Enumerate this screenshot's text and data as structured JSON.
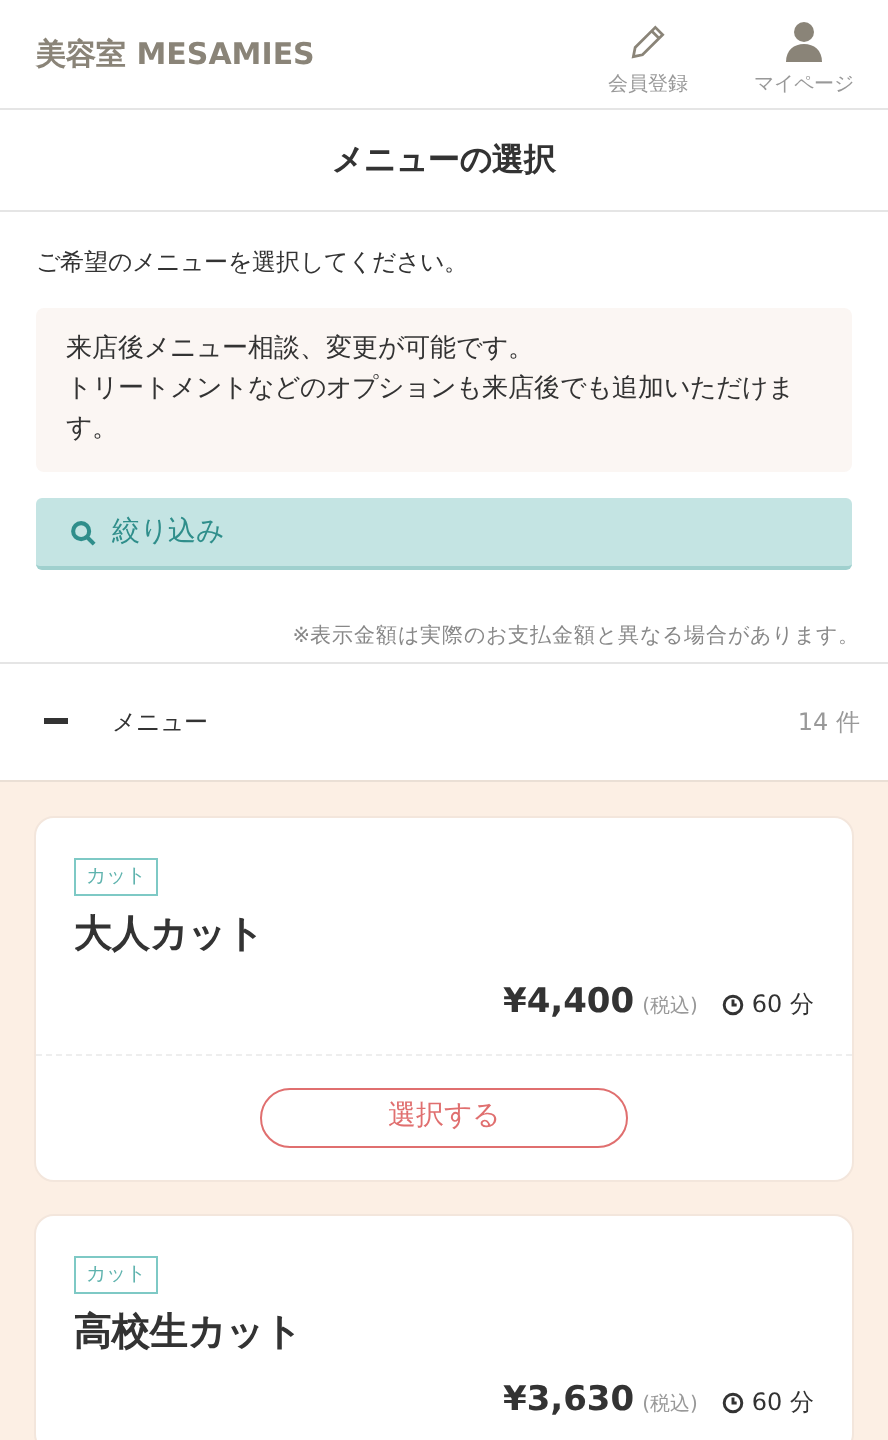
{
  "header": {
    "shop_name": "美容室 MESAMIES",
    "nav": [
      {
        "kind": "register",
        "label": "会員登録"
      },
      {
        "kind": "mypage",
        "label": "マイページ"
      }
    ]
  },
  "page_title": "メニューの選択",
  "intro": "ご希望のメニューを選択してください。",
  "info": [
    "来店後メニュー相談、変更が可能です。",
    "トリートメントなどのオプションも来店後でも追加いただけます。"
  ],
  "filter_button": "絞り込み",
  "price_note": "※表示金額は実際のお支払金額と異なる場合があります。",
  "section": {
    "title": "メニュー",
    "count": "14 件"
  },
  "menus": [
    {
      "category": "カット",
      "name": "大人カット",
      "price": "¥4,400",
      "tax": "(税込)",
      "duration": "60 分",
      "button": "選択する"
    },
    {
      "category": "カット",
      "name": "高校生カット",
      "price": "¥3,630",
      "tax": "(税込)",
      "duration": "60 分"
    }
  ]
}
